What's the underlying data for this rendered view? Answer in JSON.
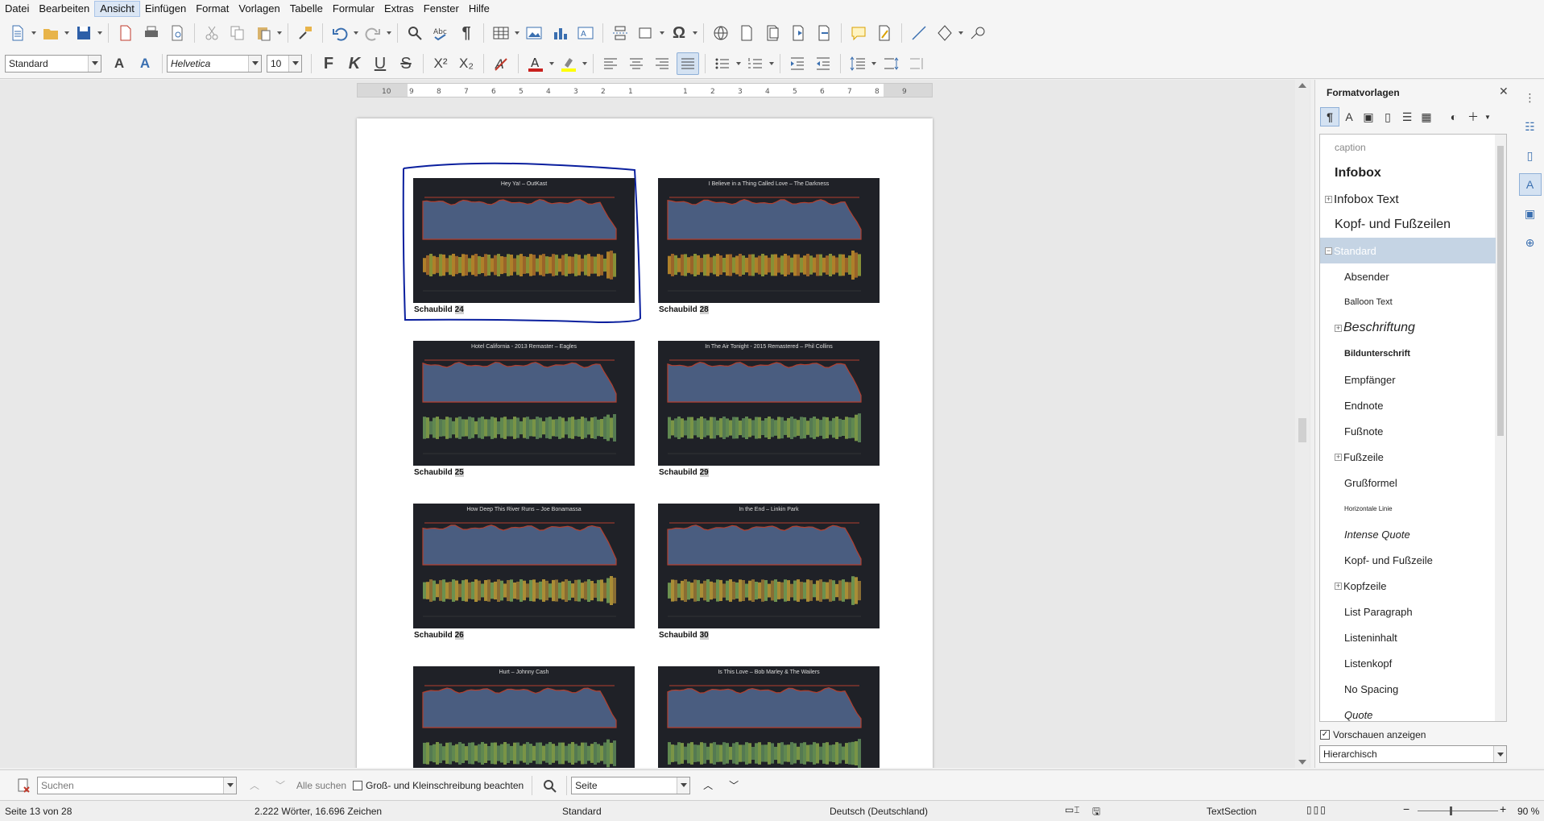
{
  "menu": [
    "Datei",
    "Bearbeiten",
    "Ansicht",
    "Einfügen",
    "Format",
    "Vorlagen",
    "Tabelle",
    "Formular",
    "Extras",
    "Fenster",
    "Hilfe"
  ],
  "menu_active": "Ansicht",
  "toolbar": {
    "para_style": "Standard",
    "font_name": "Helvetica",
    "font_size": "10",
    "bold_glyph": "F",
    "italic_glyph": "K",
    "underline_glyph": "U",
    "strike_glyph": "S",
    "superscript_glyph": "X²",
    "subscript_glyph": "X₂"
  },
  "ruler": {
    "ticks": [
      "10",
      "9",
      "8",
      "7",
      "6",
      "5",
      "4",
      "3",
      "2",
      "1",
      "1",
      "2",
      "3",
      "4",
      "5",
      "6",
      "7",
      "8",
      "9"
    ]
  },
  "charts": [
    {
      "title": "Hey Ya! – OutKast",
      "caption_label": "Schaubild",
      "caption_num": "24",
      "wave": "orange"
    },
    {
      "title": "I Believe in a Thing Called Love – The Darkness",
      "caption_label": "Schaubild",
      "caption_num": "28",
      "wave": "orange"
    },
    {
      "title": "Hotel California - 2013 Remaster – Eagles",
      "caption_label": "Schaubild",
      "caption_num": "25",
      "wave": "green"
    },
    {
      "title": "In The Air Tonight - 2015 Remastered – Phil Collins",
      "caption_label": "Schaubild",
      "caption_num": "29",
      "wave": "green"
    },
    {
      "title": "How Deep This River Runs – Joe Bonamassa",
      "caption_label": "Schaubild",
      "caption_num": "26",
      "wave": "mixed"
    },
    {
      "title": "In the End – Linkin Park",
      "caption_label": "Schaubild",
      "caption_num": "30",
      "wave": "mixed"
    },
    {
      "title": "Hurt – Johnny Cash",
      "caption_label": "",
      "caption_num": "",
      "wave": "green"
    },
    {
      "title": "Is This Love – Bob Marley & The Wailers",
      "caption_label": "",
      "caption_num": "",
      "wave": "green"
    }
  ],
  "sidebar": {
    "title": "Formatvorlagen",
    "styles": [
      {
        "name": "caption",
        "cls": "caption"
      },
      {
        "name": "Infobox",
        "cls": "infobox"
      },
      {
        "name": "Infobox Text",
        "cls": "infoboxtext",
        "expand": "+"
      },
      {
        "name": "Kopf- und Fußzeilen",
        "cls": "kopffuss"
      },
      {
        "name": "Standard",
        "cls": "standard",
        "expand": "−",
        "selected": true
      },
      {
        "name": "Absender",
        "cls": "normal"
      },
      {
        "name": "Balloon Text",
        "cls": "small"
      },
      {
        "name": "Beschriftung",
        "cls": "beschriftung",
        "expand": "+"
      },
      {
        "name": "Bildunterschrift",
        "cls": "bold"
      },
      {
        "name": "Empfänger",
        "cls": "normal"
      },
      {
        "name": "Endnote",
        "cls": "normal"
      },
      {
        "name": "Fußnote",
        "cls": "normal"
      },
      {
        "name": "Fußzeile",
        "cls": "normal",
        "expand": "+"
      },
      {
        "name": "Grußformel",
        "cls": "normal"
      },
      {
        "name": "Horizontale Linie",
        "cls": "tiny"
      },
      {
        "name": "Intense Quote",
        "cls": "italic"
      },
      {
        "name": "Kopf- und Fußzeile",
        "cls": "normal"
      },
      {
        "name": "Kopfzeile",
        "cls": "normal",
        "expand": "+"
      },
      {
        "name": "List Paragraph",
        "cls": "normal"
      },
      {
        "name": "Listeninhalt",
        "cls": "normal"
      },
      {
        "name": "Listenkopf",
        "cls": "normal"
      },
      {
        "name": "No Spacing",
        "cls": "normal"
      },
      {
        "name": "Quote",
        "cls": "italic"
      }
    ],
    "preview_label": "Vorschauen anzeigen",
    "preview_checked": "✓",
    "filter": "Hierarchisch"
  },
  "findbar": {
    "placeholder": "Suchen",
    "find_all": "Alle suchen",
    "match_case": "Groß- und Kleinschreibung beachten",
    "nav_mode": "Seite"
  },
  "status": {
    "page": "Seite 13 von 28",
    "words": "2.222 Wörter, 16.696 Zeichen",
    "page_style": "Standard",
    "language": "Deutsch (Deutschland)",
    "section": "TextSection",
    "zoom": "90 %"
  },
  "colors": {
    "selection_blue": "#0a1f9e",
    "chart_bg": "#1f2127",
    "area_blue": "#4a5d80",
    "peak_red": "#b3402f"
  }
}
